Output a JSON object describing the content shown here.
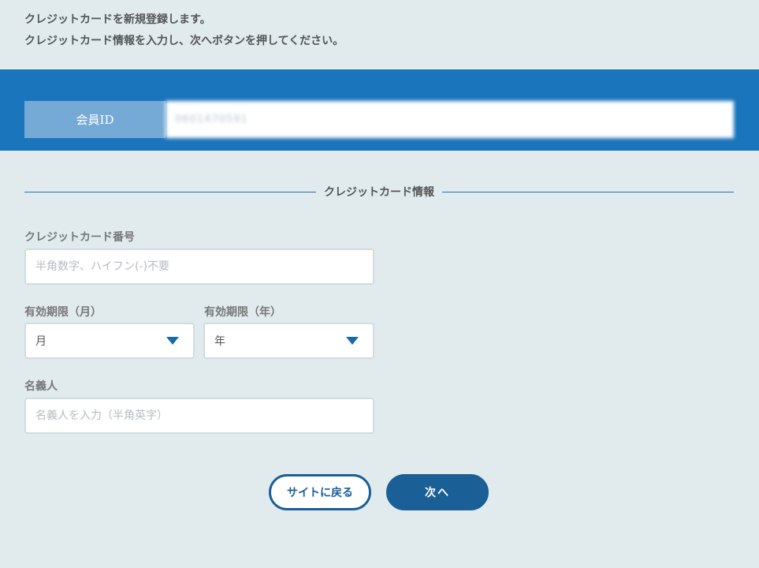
{
  "intro": {
    "line1": "クレジットカードを新規登録します。",
    "line2": "クレジットカード情報を入力し、次へボタンを押してください。"
  },
  "member": {
    "label": "会員ID",
    "value": "0601470591"
  },
  "section": {
    "title": "クレジットカード情報"
  },
  "card_number": {
    "label": "クレジットカード番号",
    "placeholder": "半角数字、ハイフン(-)不要",
    "value": ""
  },
  "expiry_month": {
    "label": "有効期限（月）",
    "selected": "月"
  },
  "expiry_year": {
    "label": "有効期限（年）",
    "selected": "年"
  },
  "holder_name": {
    "label": "名義人",
    "placeholder": "名義人を入力（半角英字）",
    "value": ""
  },
  "buttons": {
    "back": "サイトに戻る",
    "next": "次へ"
  },
  "colors": {
    "band": "#1b75bc",
    "label_bg": "#76aad6",
    "button": "#1b5f97",
    "page_bg": "#e1ebed"
  },
  "icons": {
    "dropdown": "caret-down-icon"
  }
}
